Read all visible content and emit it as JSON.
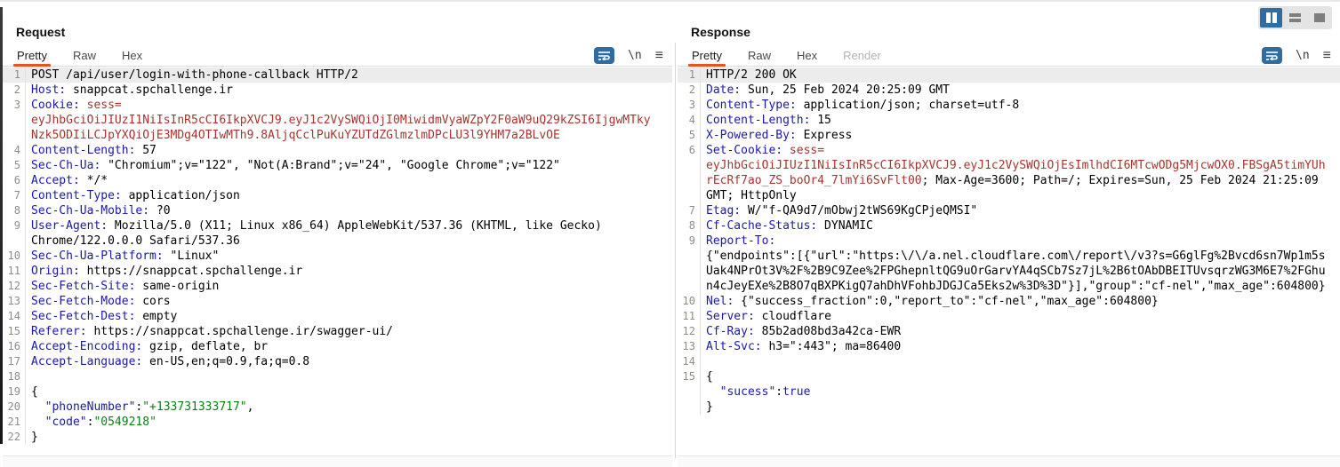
{
  "colors": {
    "accent_orange": "#e8521d",
    "icon_blue": "#2e6da4",
    "header_name_navy": "#1a1aa8",
    "token_red": "#a5352e",
    "json_string_green": "#0b7f10",
    "line_highlight": "#ececec"
  },
  "icons": {
    "wrap": "word-wrap-toggle",
    "newline": "\\n",
    "menu": "≡",
    "layout_columns": "side-by-side-layout",
    "layout_stacked": "stacked-layout",
    "layout_single": "single-panel-layout"
  },
  "request": {
    "title": "Request",
    "tabs": [
      {
        "label": "Pretty"
      },
      {
        "label": "Raw"
      },
      {
        "label": "Hex"
      }
    ],
    "lines": [
      {
        "n": "1",
        "hl": true,
        "s": [
          [
            "t",
            "POST /api/user/login-with-phone-callback HTTP/2"
          ]
        ]
      },
      {
        "n": "2",
        "s": [
          [
            "k",
            "Host:"
          ],
          [
            "t",
            " snappcat.spchallenge.ir"
          ]
        ]
      },
      {
        "n": "3",
        "s": [
          [
            "k",
            "Cookie:"
          ],
          [
            "t",
            " "
          ],
          [
            "r",
            "sess="
          ]
        ]
      },
      {
        "s": [
          [
            "r",
            "eyJhbGciOiJIUzI1NiIsInR5cCI6IkpXVCJ9.eyJ1c2VySWQiOjI0MiwidmVyaWZpY2F0aW9uQ29kZSI6IjgwMTky"
          ]
        ]
      },
      {
        "s": [
          [
            "r",
            "Nzk5ODIiLCJpYXQiOjE3MDg4OTIwMTh9.8AljqCclPuKuYZUTdZGlmzlmDPcLU3l9YHM7a2BLvOE"
          ]
        ]
      },
      {
        "n": "4",
        "s": [
          [
            "k",
            "Content-Length:"
          ],
          [
            "t",
            " 57"
          ]
        ]
      },
      {
        "n": "5",
        "s": [
          [
            "k",
            "Sec-Ch-Ua:"
          ],
          [
            "t",
            " \"Chromium\";v=\"122\", \"Not(A:Brand\";v=\"24\", \"Google Chrome\";v=\"122\""
          ]
        ]
      },
      {
        "n": "6",
        "s": [
          [
            "k",
            "Accept:"
          ],
          [
            "t",
            " */*"
          ]
        ]
      },
      {
        "n": "7",
        "s": [
          [
            "k",
            "Content-Type:"
          ],
          [
            "t",
            " application/json"
          ]
        ]
      },
      {
        "n": "8",
        "s": [
          [
            "k",
            "Sec-Ch-Ua-Mobile:"
          ],
          [
            "t",
            " ?0"
          ]
        ]
      },
      {
        "n": "9",
        "s": [
          [
            "k",
            "User-Agent:"
          ],
          [
            "t",
            " Mozilla/5.0 (X11; Linux x86_64) AppleWebKit/537.36 (KHTML, like Gecko)"
          ]
        ]
      },
      {
        "s": [
          [
            "t",
            "Chrome/122.0.0.0 Safari/537.36"
          ]
        ]
      },
      {
        "n": "10",
        "s": [
          [
            "k",
            "Sec-Ch-Ua-Platform:"
          ],
          [
            "t",
            " \"Linux\""
          ]
        ]
      },
      {
        "n": "11",
        "s": [
          [
            "k",
            "Origin:"
          ],
          [
            "t",
            " https://snappcat.spchallenge.ir"
          ]
        ]
      },
      {
        "n": "12",
        "s": [
          [
            "k",
            "Sec-Fetch-Site:"
          ],
          [
            "t",
            " same-origin"
          ]
        ]
      },
      {
        "n": "13",
        "s": [
          [
            "k",
            "Sec-Fetch-Mode:"
          ],
          [
            "t",
            " cors"
          ]
        ]
      },
      {
        "n": "14",
        "s": [
          [
            "k",
            "Sec-Fetch-Dest:"
          ],
          [
            "t",
            " empty"
          ]
        ]
      },
      {
        "n": "15",
        "s": [
          [
            "k",
            "Referer:"
          ],
          [
            "t",
            " https://snappcat.spchallenge.ir/swagger-ui/"
          ]
        ]
      },
      {
        "n": "16",
        "s": [
          [
            "k",
            "Accept-Encoding:"
          ],
          [
            "t",
            " gzip, deflate, br"
          ]
        ]
      },
      {
        "n": "17",
        "s": [
          [
            "k",
            "Accept-Language:"
          ],
          [
            "t",
            " en-US,en;q=0.9,fa;q=0.8"
          ]
        ]
      },
      {
        "n": "18",
        "s": []
      },
      {
        "n": "19",
        "s": [
          [
            "t",
            "{"
          ]
        ]
      },
      {
        "n": "20",
        "s": [
          [
            "k",
            "  \"phoneNumber\""
          ],
          [
            "t",
            ":"
          ],
          [
            "g",
            "\"+133731333717\""
          ],
          [
            "t",
            ","
          ]
        ]
      },
      {
        "n": "21",
        "s": [
          [
            "k",
            "  \"code\""
          ],
          [
            "t",
            ":"
          ],
          [
            "g",
            "\"0549218\""
          ]
        ]
      },
      {
        "n": "22",
        "s": [
          [
            "t",
            "}"
          ]
        ]
      }
    ]
  },
  "response": {
    "title": "Response",
    "tabs": [
      {
        "label": "Pretty"
      },
      {
        "label": "Raw"
      },
      {
        "label": "Hex"
      },
      {
        "label": "Render",
        "disabled": true
      }
    ],
    "lines": [
      {
        "n": "1",
        "hl": true,
        "s": [
          [
            "t",
            "HTTP/2 200 OK"
          ]
        ]
      },
      {
        "n": "2",
        "s": [
          [
            "k",
            "Date:"
          ],
          [
            "t",
            " Sun, 25 Feb 2024 20:25:09 GMT"
          ]
        ]
      },
      {
        "n": "3",
        "s": [
          [
            "k",
            "Content-Type:"
          ],
          [
            "t",
            " application/json; charset=utf-8"
          ]
        ]
      },
      {
        "n": "4",
        "s": [
          [
            "k",
            "Content-Length:"
          ],
          [
            "t",
            " 15"
          ]
        ]
      },
      {
        "n": "5",
        "s": [
          [
            "k",
            "X-Powered-By:"
          ],
          [
            "t",
            " Express"
          ]
        ]
      },
      {
        "n": "6",
        "s": [
          [
            "k",
            "Set-Cookie:"
          ],
          [
            "t",
            " "
          ],
          [
            "r",
            "sess="
          ]
        ]
      },
      {
        "s": [
          [
            "r",
            "eyJhbGciOiJIUzI1NiIsInR5cCI6IkpXVCJ9.eyJ1c2VySWQiOjEsImlhdCI6MTcwODg5MjcwOX0.FBSgA5timYUh"
          ]
        ]
      },
      {
        "s": [
          [
            "r",
            "rEcRf7ao_ZS_boOr4_7lmYi6SvFlt00"
          ],
          [
            "t",
            "; Max-Age=3600; Path=/; Expires=Sun, 25 Feb 2024 21:25:09"
          ]
        ]
      },
      {
        "s": [
          [
            "t",
            "GMT; HttpOnly"
          ]
        ]
      },
      {
        "n": "7",
        "s": [
          [
            "k",
            "Etag:"
          ],
          [
            "t",
            " W/\"f-QA9d7/mObwj2tWS69KgCPjeQMSI\""
          ]
        ]
      },
      {
        "n": "8",
        "s": [
          [
            "k",
            "Cf-Cache-Status:"
          ],
          [
            "t",
            " DYNAMIC"
          ]
        ]
      },
      {
        "n": "9",
        "s": [
          [
            "k",
            "Report-To:"
          ]
        ]
      },
      {
        "s": [
          [
            "t",
            "{\"endpoints\":[{\"url\":\"https:\\/\\/a.nel.cloudflare.com\\/report\\/v3?s=G6glFg%2Bvcd6sn7Wp1m5s"
          ]
        ]
      },
      {
        "s": [
          [
            "t",
            "Uak4NPrOt3V%2F%2B9C9Zee%2FPGhepnltQG9uOrGarvYA4qSCb7Sz7jL%2B6tOAbDBEITUvsqrzWG3M6E7%2FGhu"
          ]
        ]
      },
      {
        "s": [
          [
            "t",
            "n4cJeyEXe%2B8O7qBXPKigQ7ahDhVFohbJDGJCa5Eks2w%3D%3D\"}],\"group\":\"cf-nel\",\"max_age\":604800}"
          ]
        ]
      },
      {
        "n": "10",
        "s": [
          [
            "k",
            "Nel:"
          ],
          [
            "t",
            " {\"success_fraction\":0,\"report_to\":\"cf-nel\",\"max_age\":604800}"
          ]
        ]
      },
      {
        "n": "11",
        "s": [
          [
            "k",
            "Server:"
          ],
          [
            "t",
            " cloudflare"
          ]
        ]
      },
      {
        "n": "12",
        "s": [
          [
            "k",
            "Cf-Ray:"
          ],
          [
            "t",
            " 85b2ad08bd3a42ca-EWR"
          ]
        ]
      },
      {
        "n": "13",
        "s": [
          [
            "k",
            "Alt-Svc:"
          ],
          [
            "t",
            " h3=\":443\"; ma=86400"
          ]
        ]
      },
      {
        "n": "14",
        "s": []
      },
      {
        "n": "15",
        "s": [
          [
            "t",
            "{"
          ]
        ]
      },
      {
        "s": [
          [
            "k",
            "  \"sucess\""
          ],
          [
            "t",
            ":"
          ],
          [
            "k",
            "true"
          ]
        ]
      },
      {
        "s": [
          [
            "t",
            "}"
          ]
        ]
      }
    ]
  }
}
